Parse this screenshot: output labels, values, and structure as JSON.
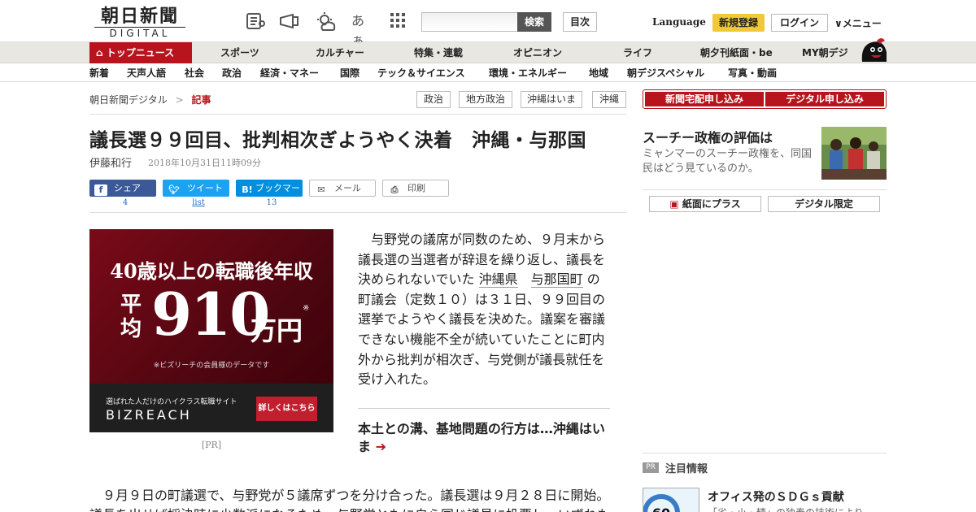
{
  "header": {
    "logo_jp": "朝日新聞",
    "logo_en": "DIGITAL",
    "search_button": "検索",
    "index_button": "目次",
    "language": "Language",
    "register": "新規登録",
    "login": "ログイン",
    "menu": "メニュー",
    "icon_text": "あぁ"
  },
  "nav_primary": [
    "トップニュース",
    "スポーツ",
    "カルチャー",
    "特集・連載",
    "オピニオン",
    "ライフ",
    "朝夕刊紙面・be",
    "MY朝デジ"
  ],
  "nav_secondary": [
    "新着",
    "天声人語",
    "社会",
    "政治",
    "経済・マネー",
    "国際",
    "テック＆サイエンス",
    "環境・エネルギー",
    "地域",
    "朝デジスペシャル",
    "写真・動画"
  ],
  "breadcrumb": {
    "home": "朝日新聞デジタル",
    "separator": ">",
    "current": "記事"
  },
  "tags": [
    "政治",
    "地方政治",
    "沖縄はいま",
    "沖縄"
  ],
  "article": {
    "title": "議長選９９回目、批判相次ぎようやく決着　沖縄・与那国",
    "author": "伊藤和行",
    "date": "2018年10月31日11時09分",
    "body_parts": [
      "与野党の議席が同数のため、９月末から議長選の当選者が辞退を繰り返し、議長を決められないでいた",
      "沖縄県",
      "与那国町",
      "の町議会（定数１０）は３１日、９９回目の選挙でようやく議長を決めた。議案を審議できない機能不全が続いていたことに町内外から批判が相次ぎ、与党側が議長就任を受け入れた。"
    ],
    "related": "本土との溝、基地問題の行方は…沖縄はいま",
    "body2": "９月９日の町議選で、与野党が５議席ずつを分け合った。議長選は９月２８日に開始。",
    "body2_partial": "議長を出せば採決時に少数派になるため、与野党ともに自ら同じ議員に投票し、いずれも"
  },
  "share": {
    "facebook": "シェア",
    "facebook_count": "4",
    "twitter": "ツイート",
    "twitter_count": "list",
    "hatena": "ブックマーク",
    "hatena_count": "13",
    "mail": "メール",
    "print": "印刷"
  },
  "ad": {
    "line1": "40歳以上の転職後年収",
    "avg": "平均",
    "number": "910",
    "unit": "万円",
    "mark": "※",
    "note": "※ビズリーチの会員様のデータです",
    "sub": "選ばれた人だけのハイクラス転職サイト",
    "brand": "BIZREACH",
    "cta": "詳しくはこちら",
    "pr": "[PR]"
  },
  "sidebar": {
    "subscribe_paper": "新聞宅配申し込み",
    "subscribe_digital": "デジタル申し込み",
    "feature_title": "スーチー政権の評価は",
    "feature_desc": "ミャンマーのスーチー政権を、同国民はどう見ているのか。",
    "btn_plus": "紙面にプラス",
    "btn_digital": "デジタル限定",
    "pr_badge": "PR",
    "attention": "注目情報",
    "promo_title": "オフィス発のＳＤＧｓ貢献",
    "promo_desc": "「省・小・精」の独奏の技術により",
    "thumb_number": "60"
  },
  "colors": {
    "brand_red": "#b8141d",
    "register_yellow": "#f0c93b",
    "facebook": "#3b5998",
    "twitter": "#1da1f2",
    "hatena": "#008fde"
  }
}
